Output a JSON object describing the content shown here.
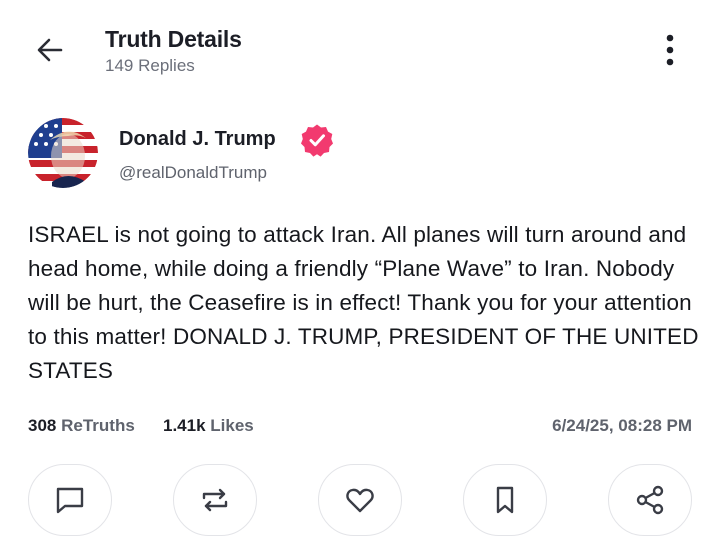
{
  "header": {
    "title": "Truth Details",
    "subtitle": "149 Replies",
    "back_icon": "arrow-left-icon",
    "more_icon": "more-vertical-icon"
  },
  "author": {
    "name": "Donald J. Trump",
    "handle": "@realDonaldTrump",
    "verified_color": "#f23a6f"
  },
  "post": {
    "text": "ISRAEL is not going to attack Iran. All planes will turn around and head home, while doing a friendly “Plane Wave” to Iran. Nobody will be hurt, the Ceasefire is in effect! Thank you for your attention to this matter! DONALD J. TRUMP, PRESIDENT OF THE UNITED STATES"
  },
  "stats": {
    "retruths_count": "308",
    "retruths_label": "ReTruths",
    "likes_count": "1.41k",
    "likes_label": "Likes",
    "timestamp": "6/24/25, 08:28 PM"
  },
  "actions": [
    {
      "name": "reply",
      "icon": "comment-icon"
    },
    {
      "name": "retruth",
      "icon": "repost-icon"
    },
    {
      "name": "like",
      "icon": "heart-icon"
    },
    {
      "name": "bookmark",
      "icon": "bookmark-icon"
    },
    {
      "name": "share",
      "icon": "share-icon"
    }
  ]
}
